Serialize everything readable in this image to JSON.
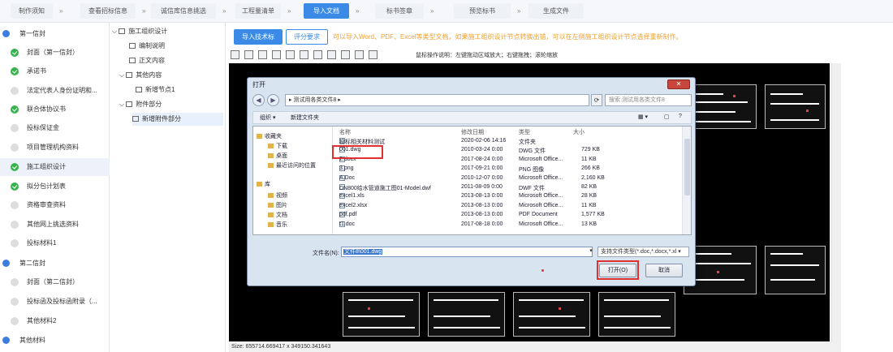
{
  "steps": [
    "制作须知",
    "查看招标信息",
    "诚信库信息挑选",
    "工程量清单",
    "导入文档",
    "标书签章",
    "预览标书",
    "生成文件"
  ],
  "step_arrow": "»",
  "active_step": 4,
  "nav": {
    "group1": "第一信封",
    "group2": "第二信封",
    "group3": "其他材料",
    "items1": [
      {
        "label": "封面（第一信封）",
        "ok": true
      },
      {
        "label": "承诺书",
        "ok": true
      },
      {
        "label": "法定代表人身份证明和...",
        "ok": false
      },
      {
        "label": "联合体协议书",
        "ok": true
      },
      {
        "label": "投标保证金",
        "ok": false
      },
      {
        "label": "项目管理机构资料",
        "ok": false
      },
      {
        "label": "施工组织设计",
        "ok": true
      },
      {
        "label": "拟分包计划表",
        "ok": true
      },
      {
        "label": "资格审查资料",
        "ok": false
      },
      {
        "label": "其他网上挑选资料",
        "ok": false
      },
      {
        "label": "投标材料1",
        "ok": false
      }
    ],
    "items2": [
      {
        "label": "封面（第二信封）",
        "ok": false
      },
      {
        "label": "投标函及投标函附录（...",
        "ok": false
      },
      {
        "label": "其他材料2",
        "ok": false
      }
    ]
  },
  "tree": {
    "root": "施工组织设计",
    "n1": "编制说明",
    "n2": "正文内容",
    "n3": "其他内容",
    "n4": "新增节点1",
    "n5": "附件部分",
    "n6": "新增附件部分"
  },
  "main": {
    "import_btn": "导入技术标",
    "req_btn": "评分要求",
    "tip": "可以导入Word、PDF、Excel等类型文档，如果施工组织设计节点转换出错，可以在左侧施工组织设计节点选择重新制作。",
    "viewer_hint": "鼠标操作说明：左键拖动区域放大；右键拖拽；滚轮缩放",
    "status": "Size: 655714.669417 x 349150.341643"
  },
  "dialog": {
    "title": "打开",
    "close": "✕",
    "path": "▸ 测试用各类文件8 ▸",
    "search": "搜索 测试用各类文件8",
    "organize": "组织 ▾",
    "new_folder": "新建文件夹",
    "left": [
      "收藏夹",
      "下载",
      "桌面",
      "最近访问的位置",
      "库",
      "视频",
      "图片",
      "文档",
      "音乐"
    ],
    "cols": [
      "名称",
      "修改日期",
      "类型",
      "大小"
    ],
    "files": [
      [
        "投标相关材料测试",
        "2020-02-06 14:16",
        "文件夹",
        ""
      ],
      [
        "001.dwg",
        "2010-03-24 0:00",
        "DWG 文件",
        "729 KB"
      ],
      [
        "2.docx",
        "2017-08-24 0:00",
        "Microsoft Office...",
        "11 KB"
      ],
      [
        "3.png",
        "2017-09-21 0:00",
        "PNG 图像",
        "266 KB"
      ],
      [
        "A.Doc",
        "2010-12-07 0:00",
        "Microsoft Office...",
        "2,160 KB"
      ],
      [
        "DN800给水管道施工图01-Model.dwf",
        "2011-08-09 0:00",
        "DWF 文件",
        "82 KB"
      ],
      [
        "excel1.xls",
        "2013-08-13 0:00",
        "Microsoft Office...",
        "28 KB"
      ],
      [
        "excel2.xlsx",
        "2013-08-13 0:00",
        "Microsoft Office...",
        "11 KB"
      ],
      [
        "pdf.pdf",
        "2013-08-13 0:00",
        "PDF Document",
        "1,577 KB"
      ],
      [
        "t1.doc",
        "2017-08-18 0:00",
        "Microsoft Office...",
        "13 KB"
      ]
    ],
    "filename_label": "文件名(N):",
    "filename_value": "文件8\\001.dwg",
    "type_filter": "支持文件类型(*.doc,*.docx,*.xl ▾",
    "open_btn": "打开(O)",
    "cancel_btn": "取消"
  },
  "colors": {
    "accent": "#3b8be6",
    "ok": "#37b24d",
    "highlight": "#e03030",
    "tip": "#f0a030"
  }
}
